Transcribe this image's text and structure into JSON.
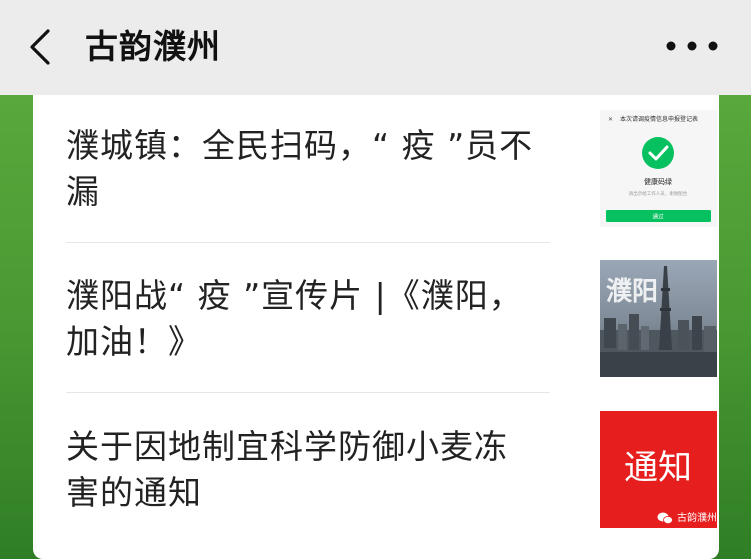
{
  "header": {
    "title": "古韵濮州",
    "back_icon": "chevron-left-icon",
    "more_icon": "more-horizontal-icon"
  },
  "articles": [
    {
      "title": "濮城镇：全民扫码，“ 疫 ”员不漏",
      "thumb": {
        "type": "qr-success-screen",
        "top_text": "本次请调疫情信息申报登记表",
        "status_text": "健康码绿",
        "sub_text": "请出示给工作人员，谢谢配合",
        "button_text": "通过",
        "icon": "check-circle-icon",
        "accent": "#07c160"
      }
    },
    {
      "title": "濮阳战“ 疫 ”宣传片 |《濮阳，加油！》",
      "thumb": {
        "type": "city-photo",
        "overlay_text": "濮阳"
      }
    },
    {
      "title": "关于因地制宜科学防御小麦冻害的通知",
      "thumb": {
        "type": "notice-banner",
        "main_text": "通知",
        "footer_text": "古韵濮州",
        "bg": "#e61e1e"
      }
    }
  ]
}
